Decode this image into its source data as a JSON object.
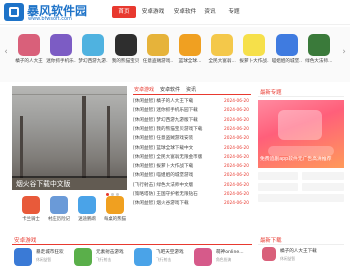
{
  "site": {
    "name": "暴风软件园",
    "url": "www.bfwsoft.com"
  },
  "nav": {
    "items": [
      "首页",
      "安卓游戏",
      "安卓软件",
      "资讯",
      "专题"
    ],
    "active_index": 0
  },
  "app_strip": {
    "items": [
      {
        "label": "橘子的人大王",
        "color": "#d9607a"
      },
      {
        "label": "迷你抓手机乐...",
        "color": "#7c5cc4"
      },
      {
        "label": "梦幻西游九游...",
        "color": "#4fb2e0"
      },
      {
        "label": "我的熊猫宝贝",
        "color": "#2e2e2e"
      },
      {
        "label": "任意盗贼游戏...",
        "color": "#e6b33a"
      },
      {
        "label": "篮球全球...",
        "color": "#f0a021"
      },
      {
        "label": "全民大富翁...",
        "color": "#f4c84a"
      },
      {
        "label": "拔萝卜大作战...",
        "color": "#f6e04a"
      },
      {
        "label": "喵姐姐的城堡...",
        "color": "#3f7be0"
      },
      {
        "label": "绿色大法师...",
        "color": "#3a7a3a"
      }
    ]
  },
  "banner": {
    "caption": "烟火谷下载中文版"
  },
  "news_tabs": {
    "items": [
      "安卓游戏",
      "安卓软件",
      "资讯"
    ],
    "active_index": 0
  },
  "news": [
    {
      "title": "[休闲益智] 橘子的人大王下载",
      "date": "2024-06-20"
    },
    {
      "title": "[休闲益智] 迷你抓手机乐园下载",
      "date": "2024-06-20"
    },
    {
      "title": "[休闲益智] 梦幻西游九游版下载",
      "date": "2024-06-20"
    },
    {
      "title": "[休闲益智] 我的熊猫宝贝游戏下载",
      "date": "2024-06-20"
    },
    {
      "title": "[休闲益智] 任意盗贼游戏安装",
      "date": "2024-06-20"
    },
    {
      "title": "[休闲益智] 篮球全球下载中文",
      "date": "2024-06-20"
    },
    {
      "title": "[休闲益智] 全民大富翁无限金币版",
      "date": "2024-06-20"
    },
    {
      "title": "[休闲益智] 拔萝卜大作战下载",
      "date": "2024-06-20"
    },
    {
      "title": "[休闲益智] 喵姐姐的城堡游戏",
      "date": "2024-06-20"
    },
    {
      "title": "[飞行射击] 绿色大法师中文版",
      "date": "2024-06-20"
    },
    {
      "title": "[策略塔防] 王国守护者无限钻石",
      "date": "2024-06-20"
    },
    {
      "title": "[休闲益智] 烟火谷游戏下载",
      "date": "2024-06-20"
    }
  ],
  "mini_apps": [
    {
      "label": "卡兰骑士",
      "color": "#e85a3a"
    },
    {
      "label": "村庄历险记",
      "color": "#6a9ad8"
    },
    {
      "label": "迷途鹦鹉",
      "color": "#4aa3e8"
    },
    {
      "label": "每桌的熊猫",
      "color": "#f0a020"
    }
  ],
  "right_column": {
    "section_title": "最新专题",
    "promo_text": "免费追剧app软件无广告高清推荐",
    "bottom_title": "最新下载",
    "bottom_item": {
      "name": "橘子的人大王下载",
      "category": "休闲益智",
      "color": "#d9607a"
    }
  },
  "bottom": {
    "section_title": "安卓游戏",
    "items": [
      {
        "name": "暴走城市狂欢",
        "category": "休闲益智",
        "color": "#3a7ad6"
      },
      {
        "name": "元素射击游戏",
        "category": "飞行射击",
        "color": "#5aaf4a"
      },
      {
        "name": "飞吧天空游戏",
        "category": "飞行射击",
        "color": "#4aa3e8"
      },
      {
        "name": "萌神online...",
        "category": "角色扮演",
        "color": "#d65a8a"
      }
    ]
  }
}
